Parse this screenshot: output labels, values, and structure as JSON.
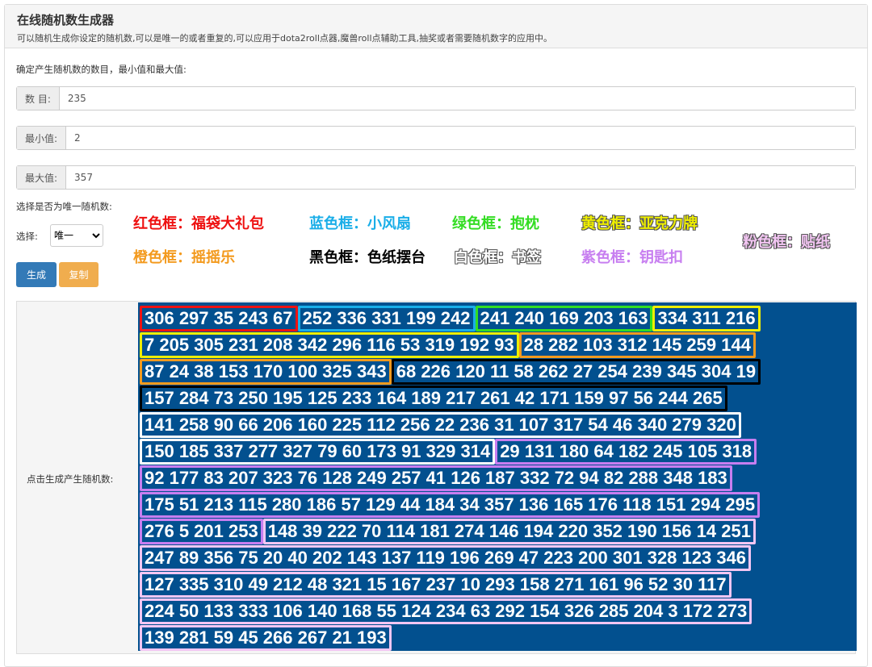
{
  "header": {
    "title": "在线随机数生成器",
    "subtitle": "可以随机生成你设定的随机数,可以是唯一的或者重复的,可以应用于dota2roll点器,魔兽roll点辅助工具,抽奖或者需要随机数字的应用中。"
  },
  "form": {
    "intro": "确定产生随机数的数目，最小值和最大值:",
    "count": {
      "label": "数 目:",
      "value": "235"
    },
    "min": {
      "label": "最小值:",
      "value": "2"
    },
    "max": {
      "label": "最大值:",
      "value": "357"
    },
    "unique_question": "选择是否为唯一随机数:",
    "select_label": "选择:",
    "select_value": "唯一",
    "generate_label": "生成",
    "copy_label": "复制",
    "output_label": "点击生成产生随机数:"
  },
  "legend": [
    {
      "text": "红色框：福袋大礼包",
      "color": "#ee1111"
    },
    {
      "text": "蓝色框：小风扇",
      "color": "#1aaee8"
    },
    {
      "text": "绿色框：抱枕",
      "color": "#33dd22"
    },
    {
      "text": "黄色框：亚克力牌",
      "color": "#eeee00"
    },
    {
      "text": "橙色框：摇摇乐",
      "color": "#f39a1e"
    },
    {
      "text": "黑色框：色纸摆台",
      "color": "#000000"
    },
    {
      "text": "白色框：书签",
      "color": "#ffffff"
    },
    {
      "text": "紫色框：钥匙扣",
      "color": "#c77ef0"
    },
    {
      "text": "粉色框：贴纸",
      "color": "#f3c6f3"
    }
  ],
  "colors": {
    "primary": "#337ab7",
    "warning": "#f0ad4e",
    "result_bg": "#02508f"
  },
  "rows": [
    [
      {
        "c": 0,
        "t": "306 297 35 243 67"
      },
      {
        "c": 1,
        "t": "252 336 331 199 242"
      },
      {
        "c": 2,
        "t": "241 240 169 203 163"
      },
      {
        "c": 3,
        "t": "334 311 216"
      }
    ],
    [
      {
        "c": 3,
        "t": "7 205 305 231 208 342 296 116 53 319 192 93"
      },
      {
        "c": 4,
        "t": "28 282 103 312 145 259 144"
      }
    ],
    [
      {
        "c": 4,
        "t": "87 24 38 153 170 100 325 343"
      },
      {
        "c": 5,
        "t": "68 226 120 11 58 262 27 254 239 345 304 19"
      }
    ],
    [
      {
        "c": 5,
        "t": "157 284 73 250 195 125 233 164 189 217 261 42 171 159 97 56 244 265"
      }
    ],
    [
      {
        "c": 6,
        "t": "141 258 90 66 206 160 225 112 256 22 236 31 107 317 54 46 340 279 320"
      }
    ],
    [
      {
        "c": 6,
        "t": "150 185 337 277 327 79 60 173 91 329 314"
      },
      {
        "c": 7,
        "t": "29 131 180 64 182 245 105 318"
      }
    ],
    [
      {
        "c": 7,
        "t": "92 177 83 207 323 76 128 249 257 41 126 187 332 72 94 82 288 348 183"
      }
    ],
    [
      {
        "c": 7,
        "t": "175 51 213 115 280 186 57 129 44 184 34 357 136 165 176 118 151 294 295"
      }
    ],
    [
      {
        "c": 7,
        "t": "276 5 201 253"
      },
      {
        "c": 8,
        "t": "148 39 222 70 114 181 274 146 194 220 352 190 156 14 251"
      }
    ],
    [
      {
        "c": 8,
        "t": "247 89 356 75 20 40 202 143 137 119 196 269 47 223 200 301 328 123 346"
      }
    ],
    [
      {
        "c": 8,
        "t": "127 335 310 49 212 48 321 15 167 237 10 293 158 271 161 96 52 30 117"
      }
    ],
    [
      {
        "c": 8,
        "t": "224 50 133 333 106 140 168 55 124 234 63 292 154 326 285 204 3 172 273"
      }
    ],
    [
      {
        "c": 8,
        "t": "139 281 59 45 266 267 21 193"
      }
    ]
  ]
}
